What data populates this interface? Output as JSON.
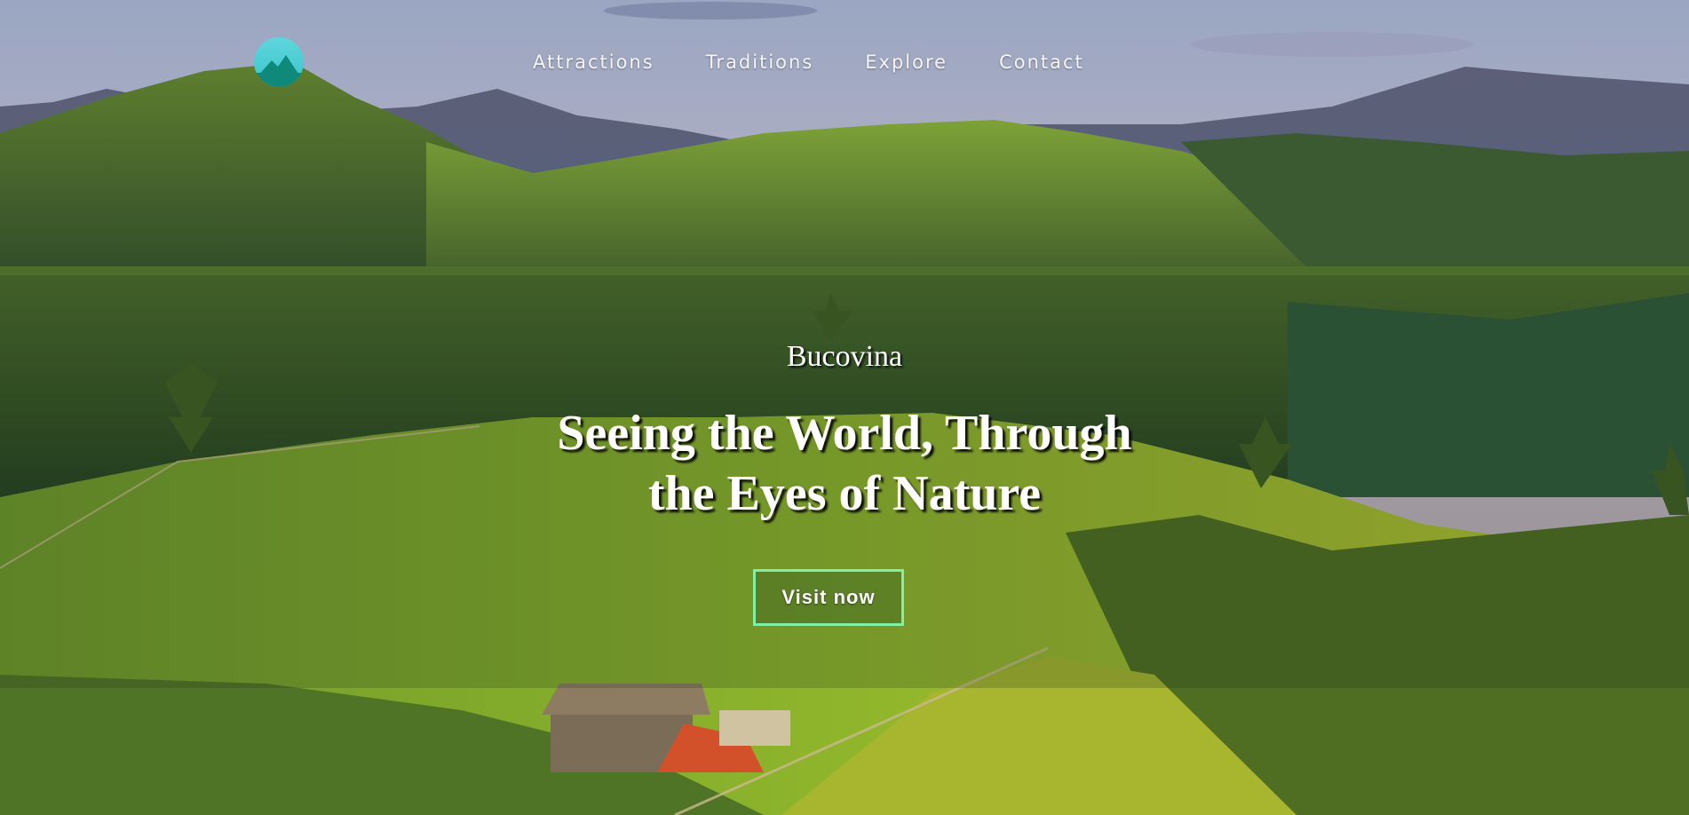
{
  "nav": {
    "logo_icon": "mountain-logo-icon",
    "items": [
      {
        "label": "Attractions"
      },
      {
        "label": "Traditions"
      },
      {
        "label": "Explore"
      },
      {
        "label": "Contact"
      }
    ]
  },
  "hero": {
    "subtitle": "Bucovina",
    "title_line1": "Seeing the World, Through",
    "title_line2": "the Eyes of Nature",
    "cta_label": "Visit now"
  },
  "colors": {
    "button_border": "#7ff0a4",
    "logo_bg": "#4fcfd4",
    "logo_mountain": "#0f8a7a"
  }
}
